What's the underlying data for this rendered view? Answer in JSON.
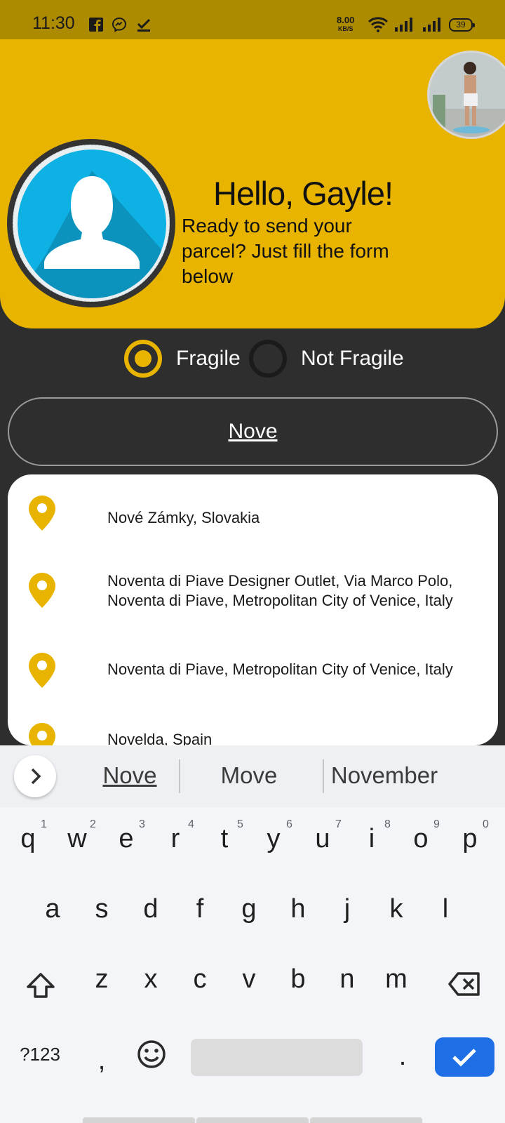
{
  "status_bar": {
    "time": "11:30",
    "net_speed_value": "8.00",
    "net_speed_unit": "KB/S",
    "battery": "39",
    "notification_icons": [
      "facebook-icon",
      "messenger-icon",
      "check-icon"
    ]
  },
  "header": {
    "greeting": "Hello, Gayle!",
    "subtitle": "Ready to send your parcel? Just fill the form below"
  },
  "parcel_type": {
    "options": [
      {
        "label": "Fragile",
        "selected": true
      },
      {
        "label": "Not Fragile",
        "selected": false
      }
    ]
  },
  "search": {
    "value": "Nove"
  },
  "suggestions": [
    {
      "text": "Nové Zámky, Slovakia"
    },
    {
      "text": "Noventa di Piave Designer Outlet, Via Marco Polo, Noventa di Piave, Metropolitan City of Venice, Italy"
    },
    {
      "text": "Noventa di Piave, Metropolitan City of Venice, Italy"
    },
    {
      "text": "Novelda, Spain"
    }
  ],
  "keyboard": {
    "suggestions": [
      "Nove",
      "Move",
      "November"
    ],
    "row1": [
      "q",
      "w",
      "e",
      "r",
      "t",
      "y",
      "u",
      "i",
      "o",
      "p"
    ],
    "row1_hints": [
      "1",
      "2",
      "3",
      "4",
      "5",
      "6",
      "7",
      "8",
      "9",
      "0"
    ],
    "row2": [
      "a",
      "s",
      "d",
      "f",
      "g",
      "h",
      "j",
      "k",
      "l"
    ],
    "row3": [
      "z",
      "x",
      "c",
      "v",
      "b",
      "n",
      "m"
    ],
    "symbols_key": "?123",
    "comma_key": ",",
    "period_key": "."
  },
  "colors": {
    "accent": "#e8b400",
    "background": "#2e2e2e",
    "status_bar": "#ad8b00",
    "enter_key": "#1e6fe6"
  }
}
